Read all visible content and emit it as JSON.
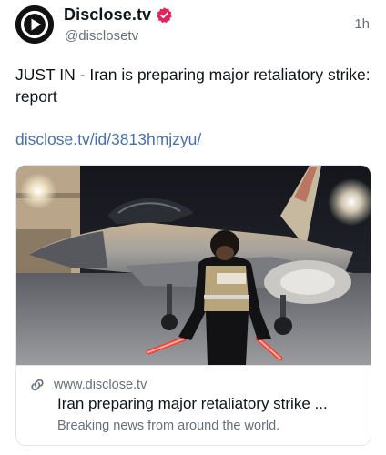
{
  "author": {
    "display_name": "Disclose.tv",
    "handle": "@disclosetv",
    "avatar_icon": "play-circle-logo",
    "verified_icon": "verified-badge-icon",
    "verified_color": "#e0245e"
  },
  "post": {
    "timestamp": "1h",
    "text": "JUST IN - Iran is preparing major retaliatory strike: report",
    "link_text": "disclose.tv/id/3813hmjzyu/",
    "link_color": "#4a6fa8"
  },
  "link_card": {
    "image_label": "IDF fighter jet with ground crew member",
    "vest_text": "סידוד י״ו",
    "domain_icon": "link-icon",
    "domain": "www.disclose.tv",
    "title": "Iran preparing major retaliatory strike ...",
    "description": "Breaking news from around the world."
  }
}
